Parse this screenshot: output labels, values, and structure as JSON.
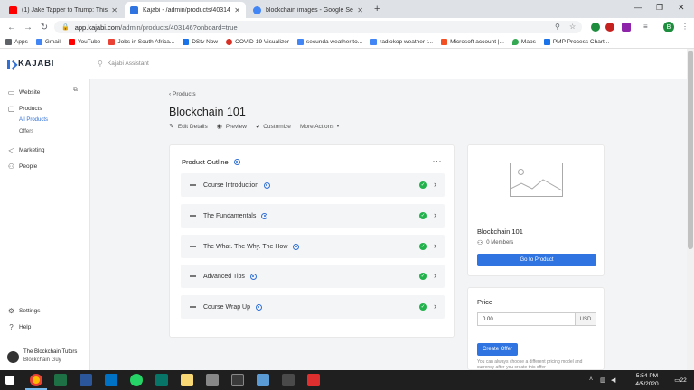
{
  "browser": {
    "tabs": [
      {
        "title": "(1) Jake Tapper to Trump: This re",
        "favicon_color": "#ff0000"
      },
      {
        "title": "Kajabi - /admin/products/40314",
        "favicon_color": "#2f74e0"
      },
      {
        "title": "blockchain images - Google Sear",
        "favicon_color": "#4285f4"
      }
    ],
    "url_host": "app.kajabi.com",
    "url_path": "/admin/products/403146?onboard=true",
    "profile_initial": "B",
    "bookmarks": [
      {
        "label": "Apps",
        "color": "#5f6368"
      },
      {
        "label": "Gmail",
        "color": "#4285f4"
      },
      {
        "label": "YouTube",
        "color": "#ff0000"
      },
      {
        "label": "Jobs in South Africa...",
        "color": "#e94235"
      },
      {
        "label": "DStv Now",
        "color": "#1a73e8"
      },
      {
        "label": "COVID-19 Visualizer",
        "color": "#d93025"
      },
      {
        "label": "secunda weather to...",
        "color": "#4285f4"
      },
      {
        "label": "radiokop weather t...",
        "color": "#4285f4"
      },
      {
        "label": "Microsoft account |...",
        "color": "#f25022"
      },
      {
        "label": "Maps",
        "color": "#34a853"
      },
      {
        "label": "PMP Process Chart...",
        "color": "#1a73e8"
      }
    ]
  },
  "app": {
    "logo": "KAJABI",
    "assistant_placeholder": "Kajabi Assistant",
    "sidebar": {
      "website": "Website",
      "products": "Products",
      "all_products": "All Products",
      "offers": "Offers",
      "marketing": "Marketing",
      "people": "People",
      "settings": "Settings",
      "help": "Help",
      "user_name": "The Blockchain Tutors",
      "user_sub": "Blockchain Guy"
    },
    "breadcrumb": "Products",
    "title": "Blockchain 101",
    "actions": [
      "Edit Details",
      "Preview",
      "Customize",
      "More Actions"
    ],
    "outline": {
      "title": "Product Outline",
      "modules": [
        "Course Introduction",
        "The Fundamentals",
        "The What. The Why. The How",
        "Advanced Tips",
        "Course Wrap Up"
      ]
    },
    "product_card": {
      "title": "Blockchain 101",
      "members": "0 Members",
      "button": "Go to Product"
    },
    "price_card": {
      "title": "Price",
      "value": "0.00",
      "currency": "USD",
      "button": "Create Offer",
      "note": "You can always choose a different pricing model and currency after you create this offer"
    }
  },
  "taskbar": {
    "time": "5:54 PM",
    "date": "4/5/2020",
    "notifications": "22"
  }
}
